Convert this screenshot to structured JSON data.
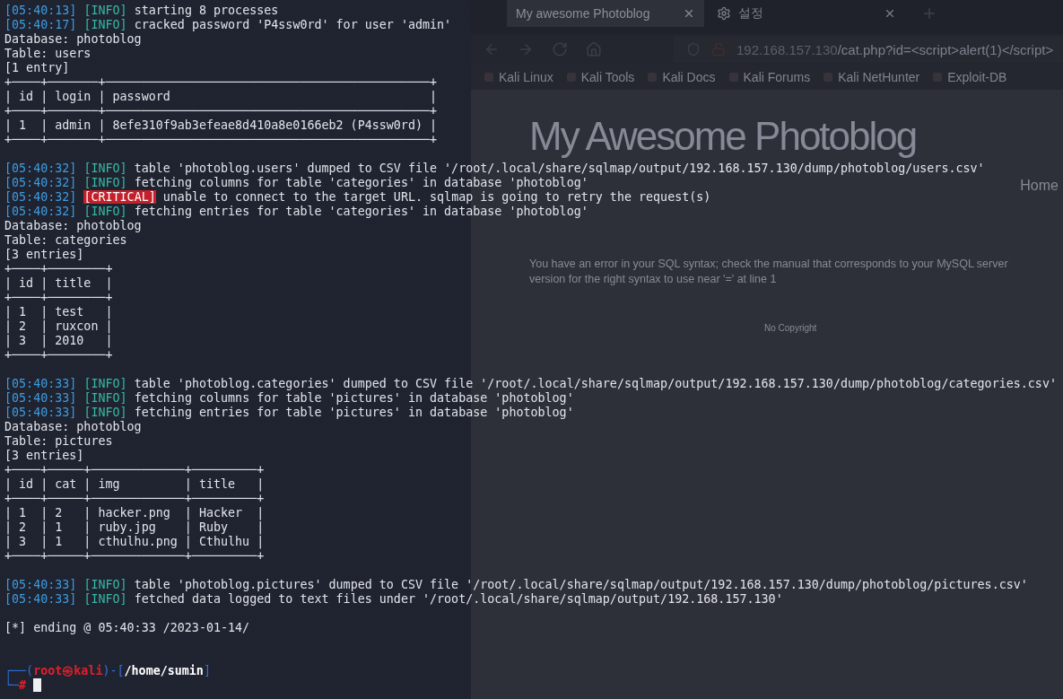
{
  "browser": {
    "tabs": [
      {
        "title": "My awesome Photoblog",
        "kind": "page",
        "selected": true
      },
      {
        "title": "설정",
        "kind": "settings",
        "selected": false
      }
    ],
    "url": {
      "host": "192.168.157.130",
      "path": "/cat.php?id=<script>alert(1)</script>"
    },
    "bookmarks": [
      "Kali Linux",
      "Kali Tools",
      "Kali Docs",
      "Kali Forums",
      "Kali NetHunter",
      "Exploit-DB"
    ],
    "page": {
      "title": "My Awesome Photoblog",
      "nav": "Home",
      "error": "You have an error in your SQL syntax; check the manual that corresponds to your MySQL server version for the right syntax to use near '=' at line 1",
      "footer": "No Copyright"
    }
  },
  "terminal": {
    "lines": [
      {
        "kind": "log",
        "time": "[05:40:13]",
        "level": "[INFO]",
        "highlighted": false,
        "message": "starting 8 processes"
      },
      {
        "kind": "log",
        "time": "[05:40:17]",
        "level": "[INFO]",
        "highlighted": false,
        "message": "cracked password 'P4ssw0rd' for user 'admin'"
      },
      {
        "kind": "text",
        "text": "Database: photoblog"
      },
      {
        "kind": "text",
        "text": "Table: users"
      },
      {
        "kind": "text",
        "text": "[1 entry]"
      },
      {
        "kind": "border",
        "text": "+────+───────+─────────────────────────────────────────────+"
      },
      {
        "kind": "row",
        "text": "| id | login | password                                    |"
      },
      {
        "kind": "border",
        "text": "+────+───────+─────────────────────────────────────────────+"
      },
      {
        "kind": "row",
        "text": "| 1  | admin | 8efe310f9ab3efeae8d410a8e0166eb2 (P4ssw0rd) |"
      },
      {
        "kind": "border",
        "text": "+────+───────+─────────────────────────────────────────────+"
      },
      {
        "kind": "blank"
      },
      {
        "kind": "log",
        "time": "[05:40:32]",
        "level": "[INFO]",
        "highlighted": false,
        "message": "table 'photoblog.users' dumped to CSV file '/root/.local/share/sqlmap/output/192.168.157.130/dump/photoblog/users.csv'"
      },
      {
        "kind": "log",
        "time": "[05:40:32]",
        "level": "[INFO]",
        "highlighted": false,
        "message": "fetching columns for table 'categories' in database 'photoblog'"
      },
      {
        "kind": "log",
        "time": "[05:40:32]",
        "level": "[CRITICAL]",
        "highlighted": true,
        "message": "unable to connect to the target URL. sqlmap is going to retry the request(s)"
      },
      {
        "kind": "log",
        "time": "[05:40:32]",
        "level": "[INFO]",
        "highlighted": false,
        "message": "fetching entries for table 'categories' in database 'photoblog'"
      },
      {
        "kind": "text",
        "text": "Database: photoblog"
      },
      {
        "kind": "text",
        "text": "Table: categories"
      },
      {
        "kind": "text",
        "text": "[3 entries]"
      },
      {
        "kind": "border",
        "text": "+────+────────+"
      },
      {
        "kind": "row",
        "text": "| id | title  |"
      },
      {
        "kind": "border",
        "text": "+────+────────+"
      },
      {
        "kind": "row",
        "text": "| 1  | test   |"
      },
      {
        "kind": "row",
        "text": "| 2  | ruxcon |"
      },
      {
        "kind": "row",
        "text": "| 3  | 2010   |"
      },
      {
        "kind": "border",
        "text": "+────+────────+"
      },
      {
        "kind": "blank"
      },
      {
        "kind": "log",
        "time": "[05:40:33]",
        "level": "[INFO]",
        "highlighted": false,
        "message": "table 'photoblog.categories' dumped to CSV file '/root/.local/share/sqlmap/output/192.168.157.130/dump/photoblog/categories.csv'"
      },
      {
        "kind": "log",
        "time": "[05:40:33]",
        "level": "[INFO]",
        "highlighted": false,
        "message": "fetching columns for table 'pictures' in database 'photoblog'"
      },
      {
        "kind": "log",
        "time": "[05:40:33]",
        "level": "[INFO]",
        "highlighted": false,
        "message": "fetching entries for table 'pictures' in database 'photoblog'"
      },
      {
        "kind": "text",
        "text": "Database: photoblog"
      },
      {
        "kind": "text",
        "text": "Table: pictures"
      },
      {
        "kind": "text",
        "text": "[3 entries]"
      },
      {
        "kind": "border",
        "text": "+────+─────+─────────────+─────────+"
      },
      {
        "kind": "row",
        "text": "| id | cat | img         | title   |"
      },
      {
        "kind": "border",
        "text": "+────+─────+─────────────+─────────+"
      },
      {
        "kind": "row",
        "text": "| 1  | 2   | hacker.png  | Hacker  |"
      },
      {
        "kind": "row",
        "text": "| 2  | 1   | ruby.jpg    | Ruby    |"
      },
      {
        "kind": "row",
        "text": "| 3  | 1   | cthulhu.png | Cthulhu |"
      },
      {
        "kind": "border",
        "text": "+────+─────+─────────────+─────────+"
      },
      {
        "kind": "blank"
      },
      {
        "kind": "log",
        "time": "[05:40:33]",
        "level": "[INFO]",
        "highlighted": false,
        "message": "table 'photoblog.pictures' dumped to CSV file '/root/.local/share/sqlmap/output/192.168.157.130/dump/photoblog/pictures.csv'"
      },
      {
        "kind": "log",
        "time": "[05:40:33]",
        "level": "[INFO]",
        "highlighted": false,
        "message": "fetched data logged to text files under '/root/.local/share/sqlmap/output/192.168.157.130'"
      },
      {
        "kind": "blank"
      },
      {
        "kind": "text",
        "text": "[*] ending @ 05:40:33 /2023-01-14/"
      },
      {
        "kind": "blank"
      },
      {
        "kind": "blank"
      },
      {
        "kind": "prompt",
        "lead": "┌──(",
        "user": "root㉿kali",
        "sep": ")-[",
        "cwd": "/home/sumin",
        "close": "]"
      },
      {
        "kind": "input",
        "lead": "└─",
        "symbol": "#"
      }
    ]
  }
}
